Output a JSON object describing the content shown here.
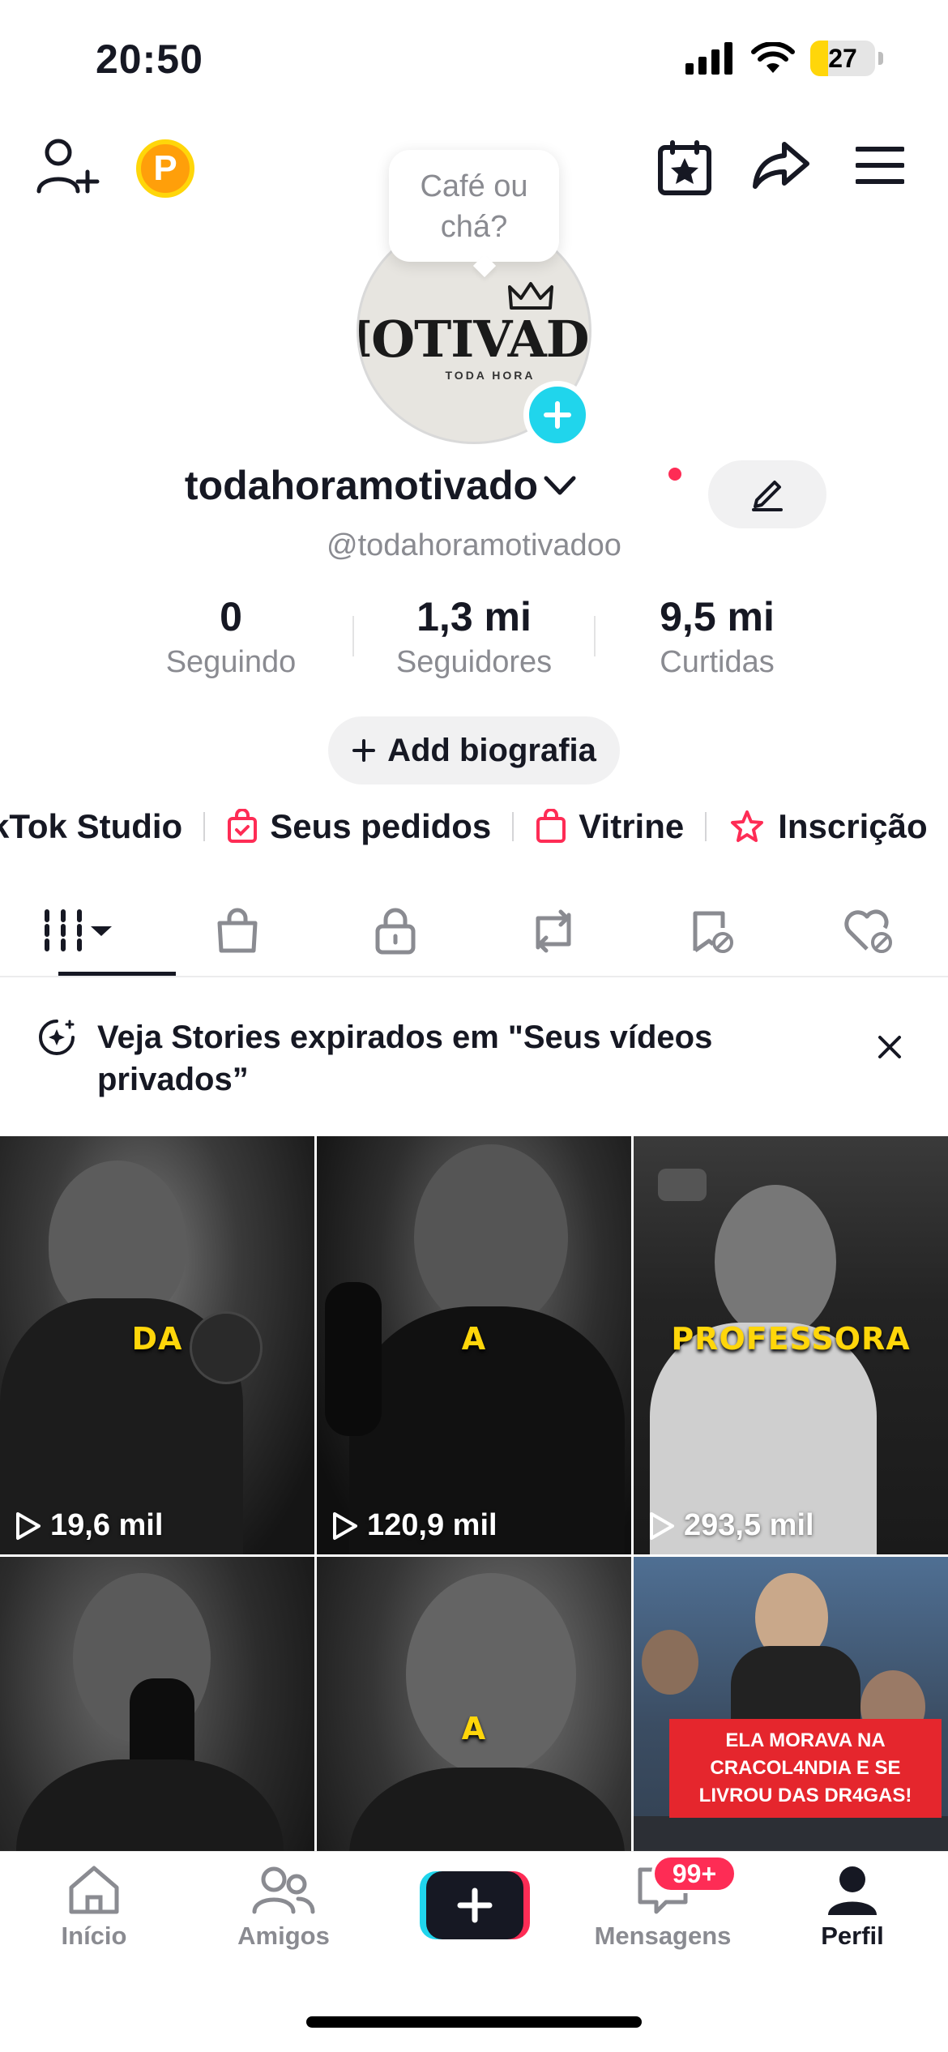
{
  "status_bar": {
    "time": "20:50",
    "battery": "27",
    "battery_level": 0.27
  },
  "profile": {
    "tooltip": "Café ou chá?",
    "avatar_logo": "MOTIVADO",
    "avatar_logo_sub": "TODA HORA",
    "display_name": "todahoramotivado",
    "handle": "@todahoramotivadoo"
  },
  "stats": [
    {
      "value": "0",
      "label": "Seguindo"
    },
    {
      "value": "1,3 mi",
      "label": "Seguidores"
    },
    {
      "value": "9,5 mi",
      "label": "Curtidas"
    }
  ],
  "bio_button": "Add biografia",
  "chips": [
    "kTok Studio",
    "Seus pedidos",
    "Vitrine",
    "Inscrição"
  ],
  "banner": {
    "text": "Veja Stories expirados em \"Seus vídeos privados”"
  },
  "videos": [
    {
      "caption": "DA",
      "views": "19,6 mil"
    },
    {
      "caption": "A",
      "views": "120,9 mil"
    },
    {
      "caption": "PROFESSORA",
      "views": "293,5 mil"
    },
    {
      "caption": "",
      "views": ""
    },
    {
      "caption": "A",
      "views": ""
    },
    {
      "caption": "ELA MORAVA NA CRACOL4NDIA E SE LIVROU DAS DR4GAS!",
      "views": ""
    }
  ],
  "bottom_nav": {
    "home": "Início",
    "friends": "Amigos",
    "messages": "Mensagens",
    "profile": "Perfil",
    "messages_badge": "99+"
  },
  "colors": {
    "accent_red": "#fe2c55",
    "accent_cyan": "#20d5ec",
    "caption_yellow": "#ffd60a"
  }
}
